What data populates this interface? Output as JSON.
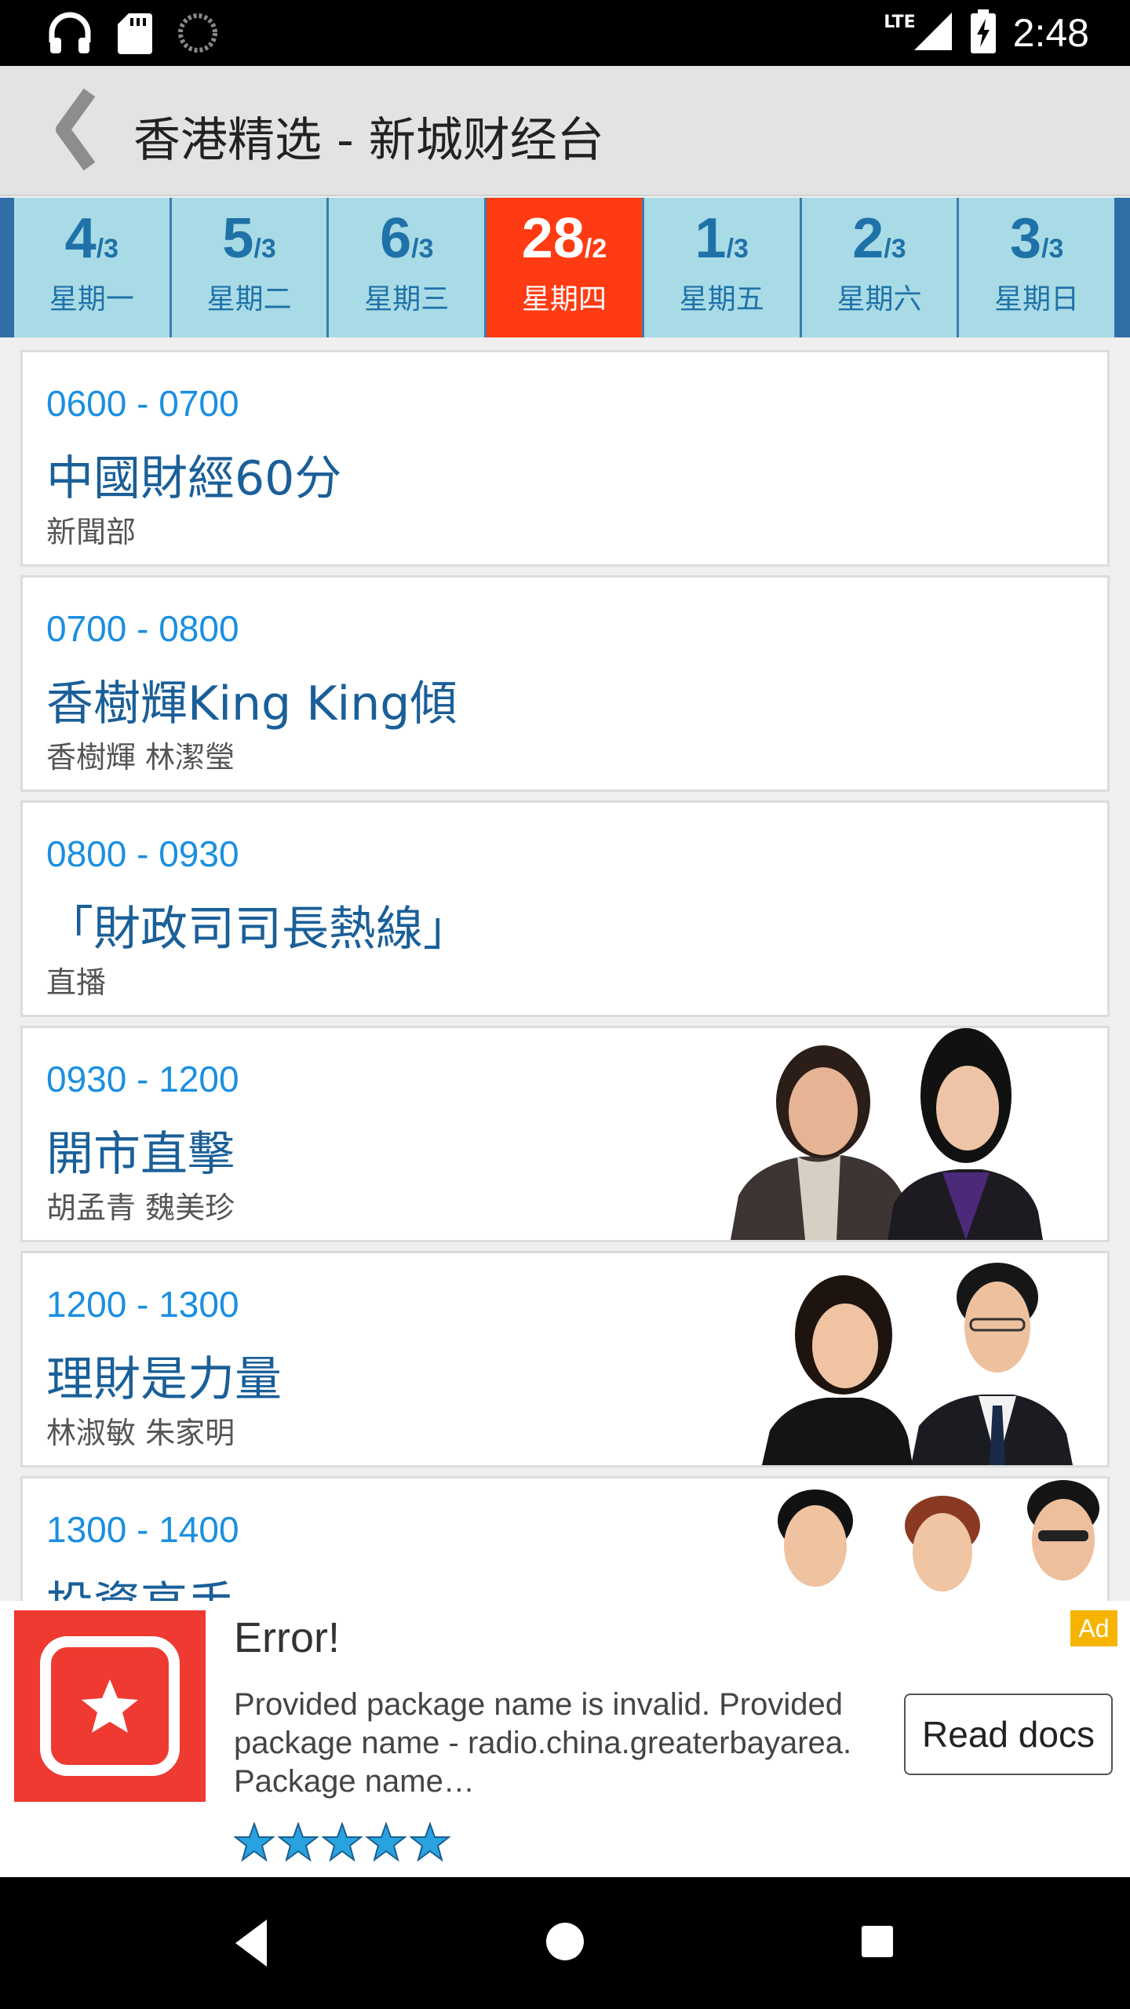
{
  "status_bar": {
    "network": "LTE",
    "time": "2:48",
    "icons": [
      "headphones-icon",
      "sd-card-icon",
      "sync-icon",
      "signal-icon",
      "battery-charging-icon"
    ]
  },
  "app_bar": {
    "title": "香港精选 - 新城财经台",
    "back_icon": "back-chevron-icon"
  },
  "days": [
    {
      "num": "4",
      "month": "/3",
      "weekday": "星期一",
      "active": false
    },
    {
      "num": "5",
      "month": "/3",
      "weekday": "星期二",
      "active": false
    },
    {
      "num": "6",
      "month": "/3",
      "weekday": "星期三",
      "active": false
    },
    {
      "num": "28",
      "month": "/2",
      "weekday": "星期四",
      "active": true
    },
    {
      "num": "1",
      "month": "/3",
      "weekday": "星期五",
      "active": false
    },
    {
      "num": "2",
      "month": "/3",
      "weekday": "星期六",
      "active": false
    },
    {
      "num": "3",
      "month": "/3",
      "weekday": "星期日",
      "active": false
    }
  ],
  "programs": [
    {
      "time": "0600 - 0700",
      "title": "中國財經60分",
      "host": "新聞部"
    },
    {
      "time": "0700 - 0800",
      "title": "香樹輝King King傾",
      "host": "香樹輝 林潔瑩"
    },
    {
      "time": "0800 - 0930",
      "title": "「財政司司長熱線」",
      "host": "直播"
    },
    {
      "time": "0930 - 1200",
      "title": "開市直擊",
      "host": "胡孟青 魏美珍"
    },
    {
      "time": "1200 - 1300",
      "title": "理財是力量",
      "host": "林淑敏 朱家明"
    },
    {
      "time": "1300 - 1400",
      "title": "投資高手",
      "host": ""
    }
  ],
  "ad": {
    "badge": "Ad",
    "title": "Error!",
    "description": "Provided package name is invalid. Provided package name - radio.china.greaterbayarea. Package name…",
    "button": "Read docs",
    "rating": 5,
    "icon": "star-app-icon",
    "colors": {
      "icon_bg": "#ef3a32",
      "badge": "#f6b400",
      "stars": "#29a3e0"
    }
  },
  "colors": {
    "active_tab": "#ff3b13",
    "tab": "#a9dbe6",
    "time_text": "#1b8fe0",
    "title_text": "#1a5f98"
  }
}
